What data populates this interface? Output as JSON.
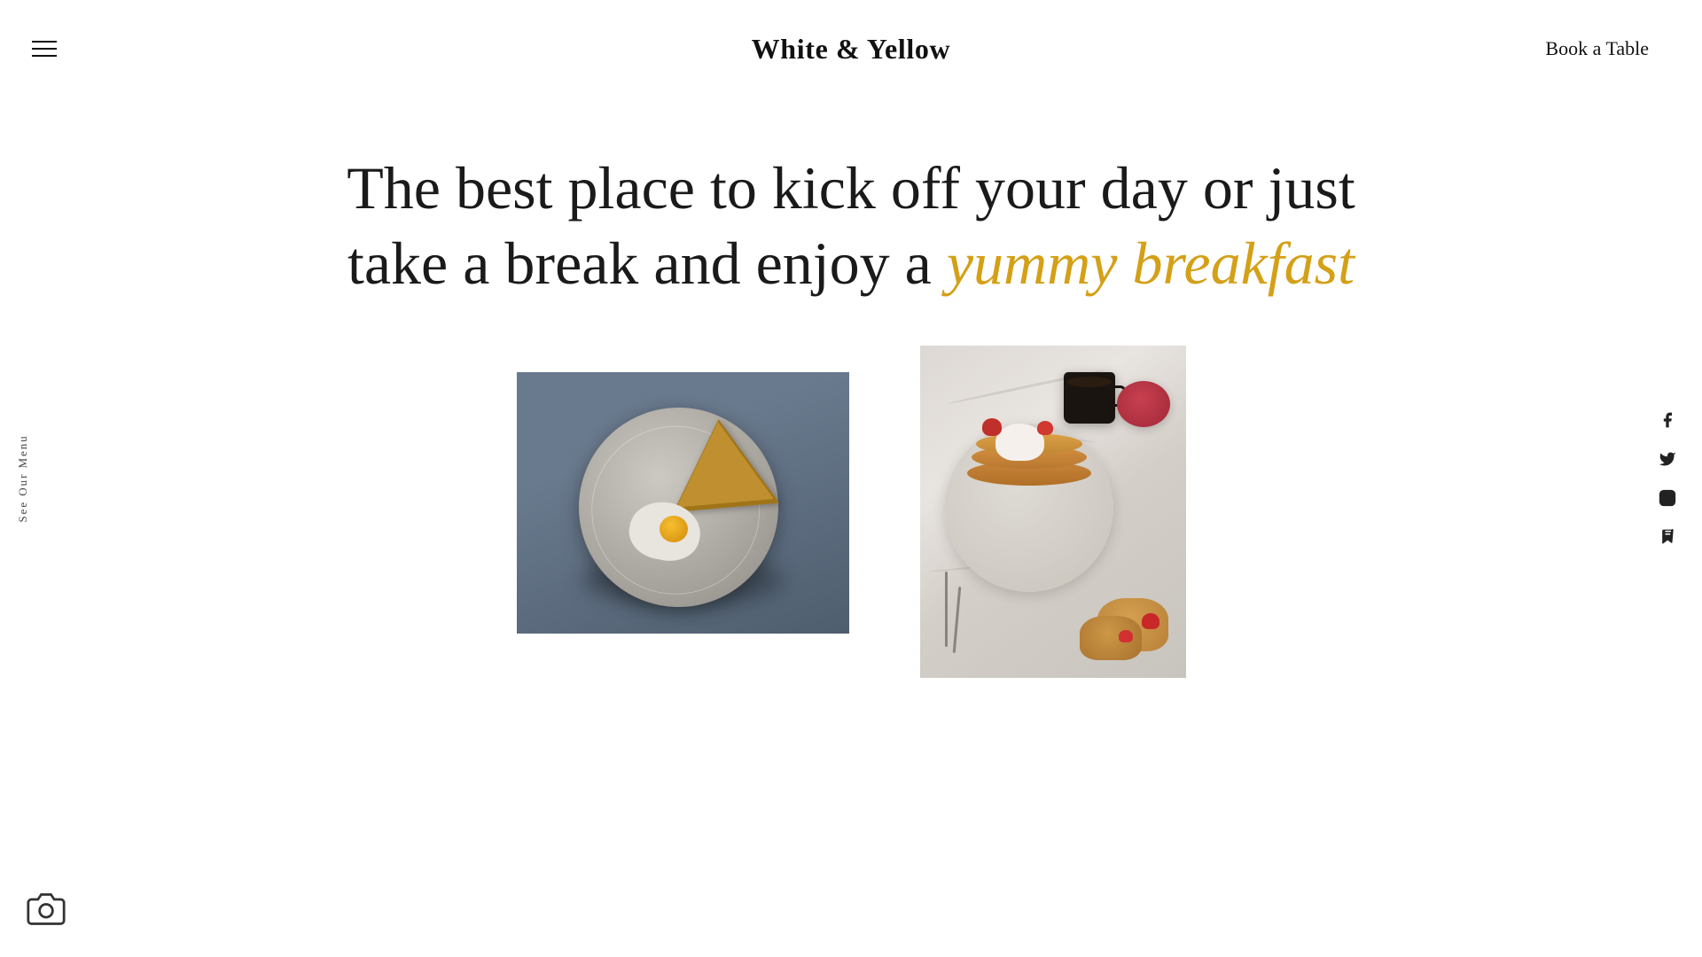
{
  "header": {
    "site_title": "White & Yellow",
    "book_table_label": "Book a Table"
  },
  "hero": {
    "text_line1": "The best place to kick off your day or just",
    "text_line2": "take a break and enjoy a",
    "text_accent": "yummy breakfast"
  },
  "side_nav": {
    "label": "See Our Menu"
  },
  "social": {
    "facebook_label": "facebook-icon",
    "twitter_label": "twitter-icon",
    "instagram_label": "instagram-icon",
    "foursquare_label": "foursquare-icon"
  },
  "camera": {
    "label": "camera-icon"
  },
  "colors": {
    "accent": "#d4a017",
    "text_dark": "#1a1a1a",
    "bg": "#ffffff"
  }
}
